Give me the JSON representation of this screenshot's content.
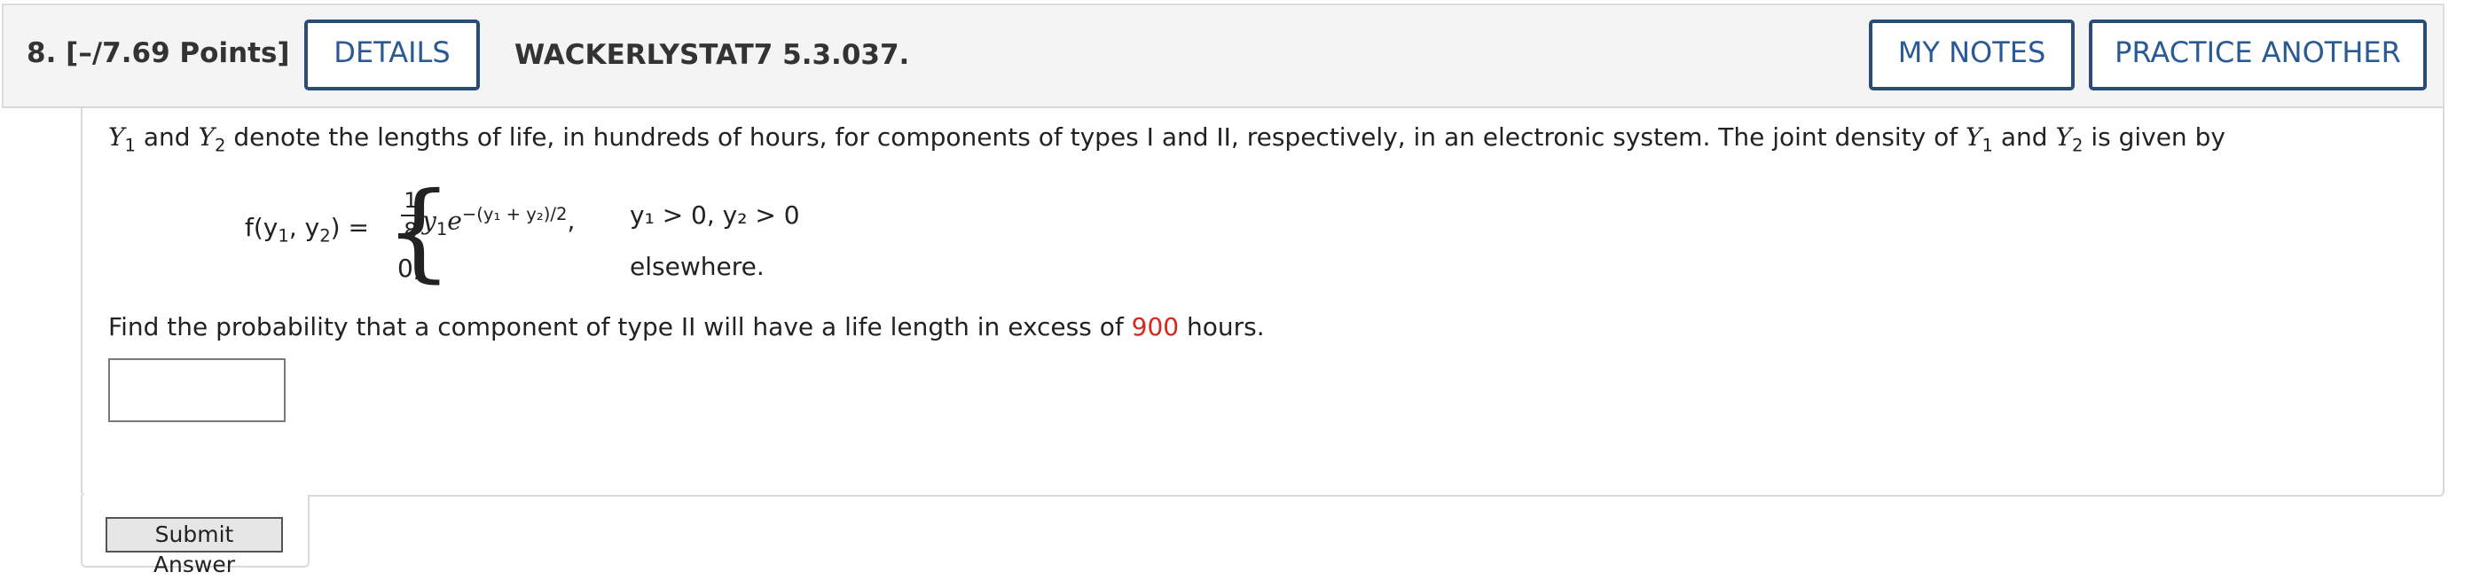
{
  "header": {
    "question_number": "8.",
    "points": "[–/7.69 Points]",
    "details_label": "DETAILS",
    "question_code": "WACKERLYSTAT7 5.3.037.",
    "my_notes_label": "MY NOTES",
    "practice_label": "PRACTICE ANOTHER"
  },
  "problem": {
    "intro_a": "and",
    "intro_b": "denote the lengths of life, in hundreds of hours, for components of types I and II, respectively, in an electronic system. The joint density of",
    "intro_c": "and",
    "intro_d": "is given by",
    "var_y": "Y",
    "sub_1": "1",
    "sub_2": "2",
    "fn_name": "f(y",
    "fn_mid": ", y",
    "fn_end": ") =",
    "frac_num": "1",
    "frac_den": "8",
    "case1_expr_a": "y",
    "case1_expr_b": "e",
    "case1_exp": "−(y₁ + y₂)/2",
    "case1_comma": ",",
    "case1_cond": "y₁ > 0, y₂ > 0",
    "case2_val": "0,",
    "case2_cond": "elsewhere.",
    "question_a": "Find the probability that a component of type II will have a life length in excess of",
    "question_value": "900",
    "question_b": "hours."
  },
  "answer": {
    "input_value": ""
  },
  "submit": {
    "label": "Submit Answer"
  },
  "colors": {
    "accent": "#2a4d78",
    "highlight": "#d42a1e"
  }
}
